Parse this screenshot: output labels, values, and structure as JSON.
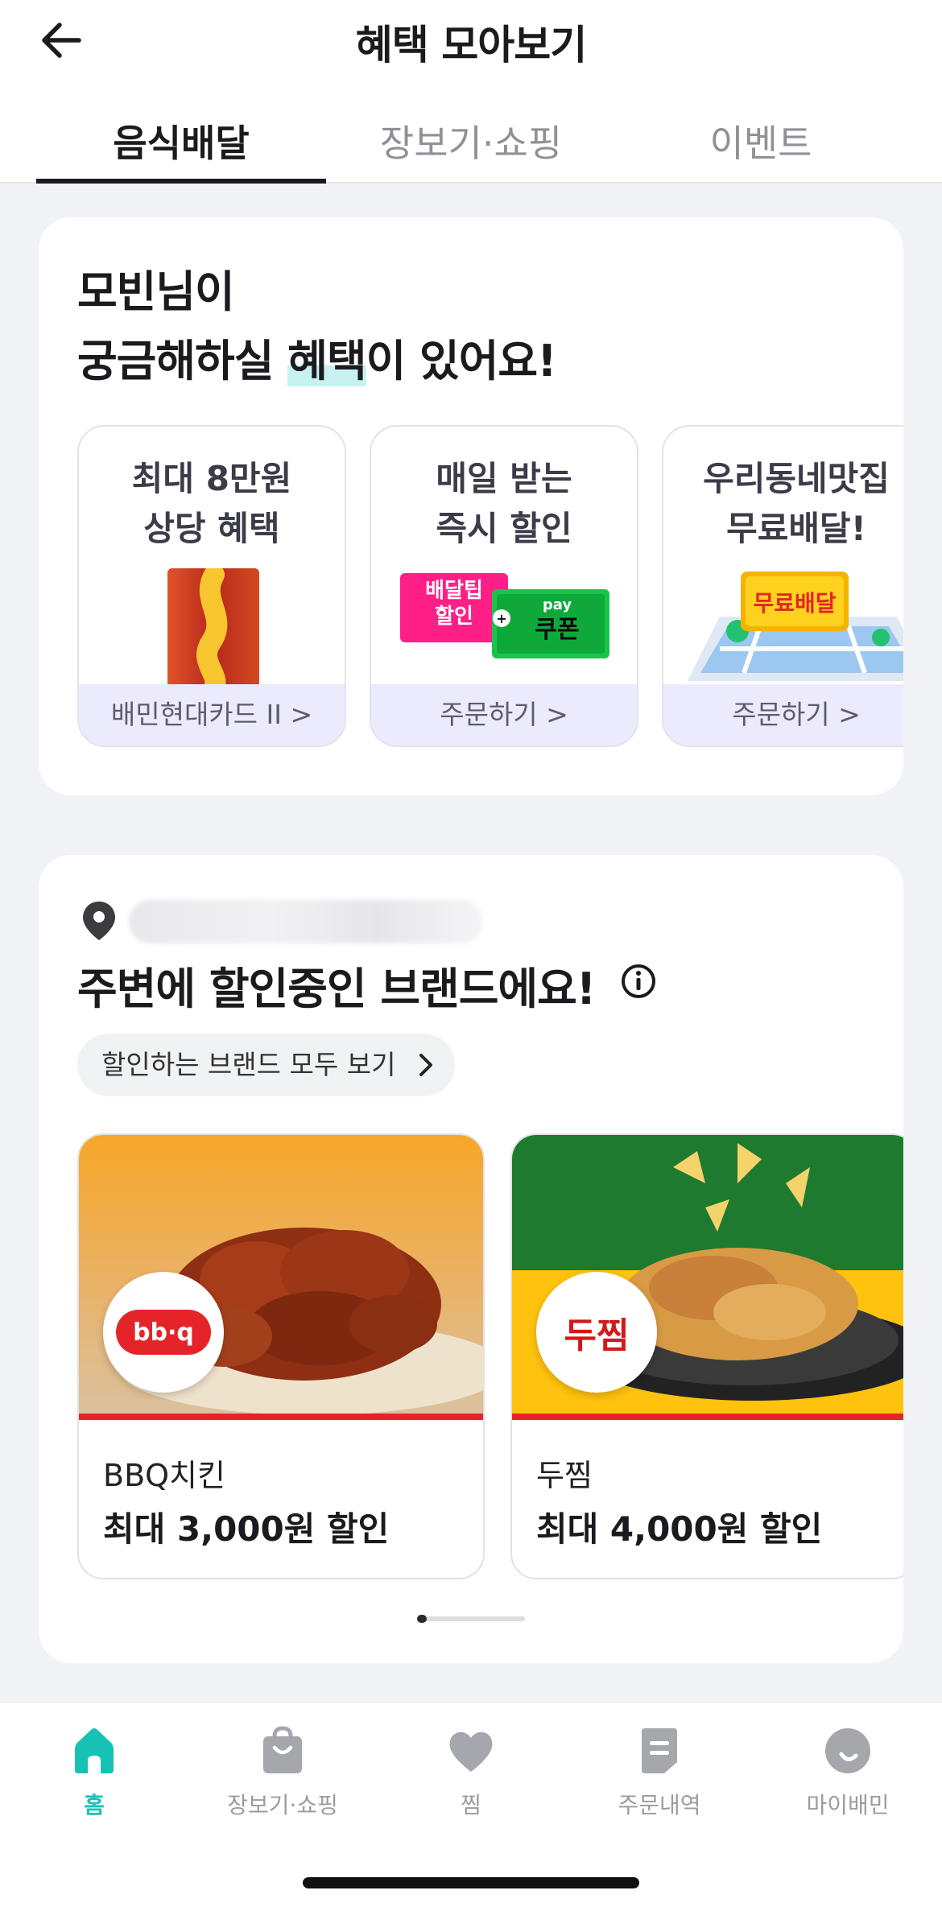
{
  "header": {
    "title": "혜택 모아보기",
    "back_icon": "arrow-left-icon"
  },
  "tabs": [
    {
      "label": "음식배달",
      "active": true
    },
    {
      "label": "장보기·쇼핑",
      "active": false
    },
    {
      "label": "이벤트",
      "active": false
    }
  ],
  "benefits_section": {
    "greeting_line1": "모빈님이",
    "greeting_line2_pre": "궁금해하실 ",
    "greeting_line2_hl": "혜택",
    "greeting_line2_post": "이 있어요!",
    "items": [
      {
        "title_line1": "최대 8만원",
        "title_line2": "상당 혜택",
        "footer": "배민현대카드 II >",
        "art": "card-illustration"
      },
      {
        "title_line1": "매일 받는",
        "title_line2": "즉시 할인",
        "footer": "주문하기 >",
        "art_tag1_line1": "배달팁",
        "art_tag1_line2": "할인",
        "art_tag2_top": "pay",
        "art_tag2": "쿠폰"
      },
      {
        "title_line1": "우리동네맛집",
        "title_line2": "무료배달!",
        "footer": "주문하기 >",
        "art_tag": "무료배달"
      }
    ]
  },
  "nearby_section": {
    "location_icon": "location-pin-icon",
    "title": "주변에 할인중인 브랜드에요!",
    "info_icon": "info-icon",
    "all_brands_label": "할인하는 브랜드 모두 보기",
    "brands": [
      {
        "name": "BBQ치킨",
        "discount": "최대 3,000원 할인",
        "logo_text": "bb·q"
      },
      {
        "name": "두찜",
        "discount": "최대 4,000원 할인",
        "logo_text": "두찜"
      }
    ],
    "carousel_progress": 0.09
  },
  "bottom_nav": [
    {
      "label": "홈",
      "icon": "home-icon",
      "active": true
    },
    {
      "label": "장보기·쇼핑",
      "icon": "shopping-bag-icon",
      "active": false
    },
    {
      "label": "찜",
      "icon": "heart-icon",
      "active": false
    },
    {
      "label": "주문내역",
      "icon": "receipt-icon",
      "active": false
    },
    {
      "label": "마이배민",
      "icon": "profile-face-icon",
      "active": false
    }
  ],
  "colors": {
    "accent": "#17c2b5",
    "discount_bar": "#e5242a",
    "background": "#f2f3f6",
    "benefit_footer": "#ecebfd"
  }
}
